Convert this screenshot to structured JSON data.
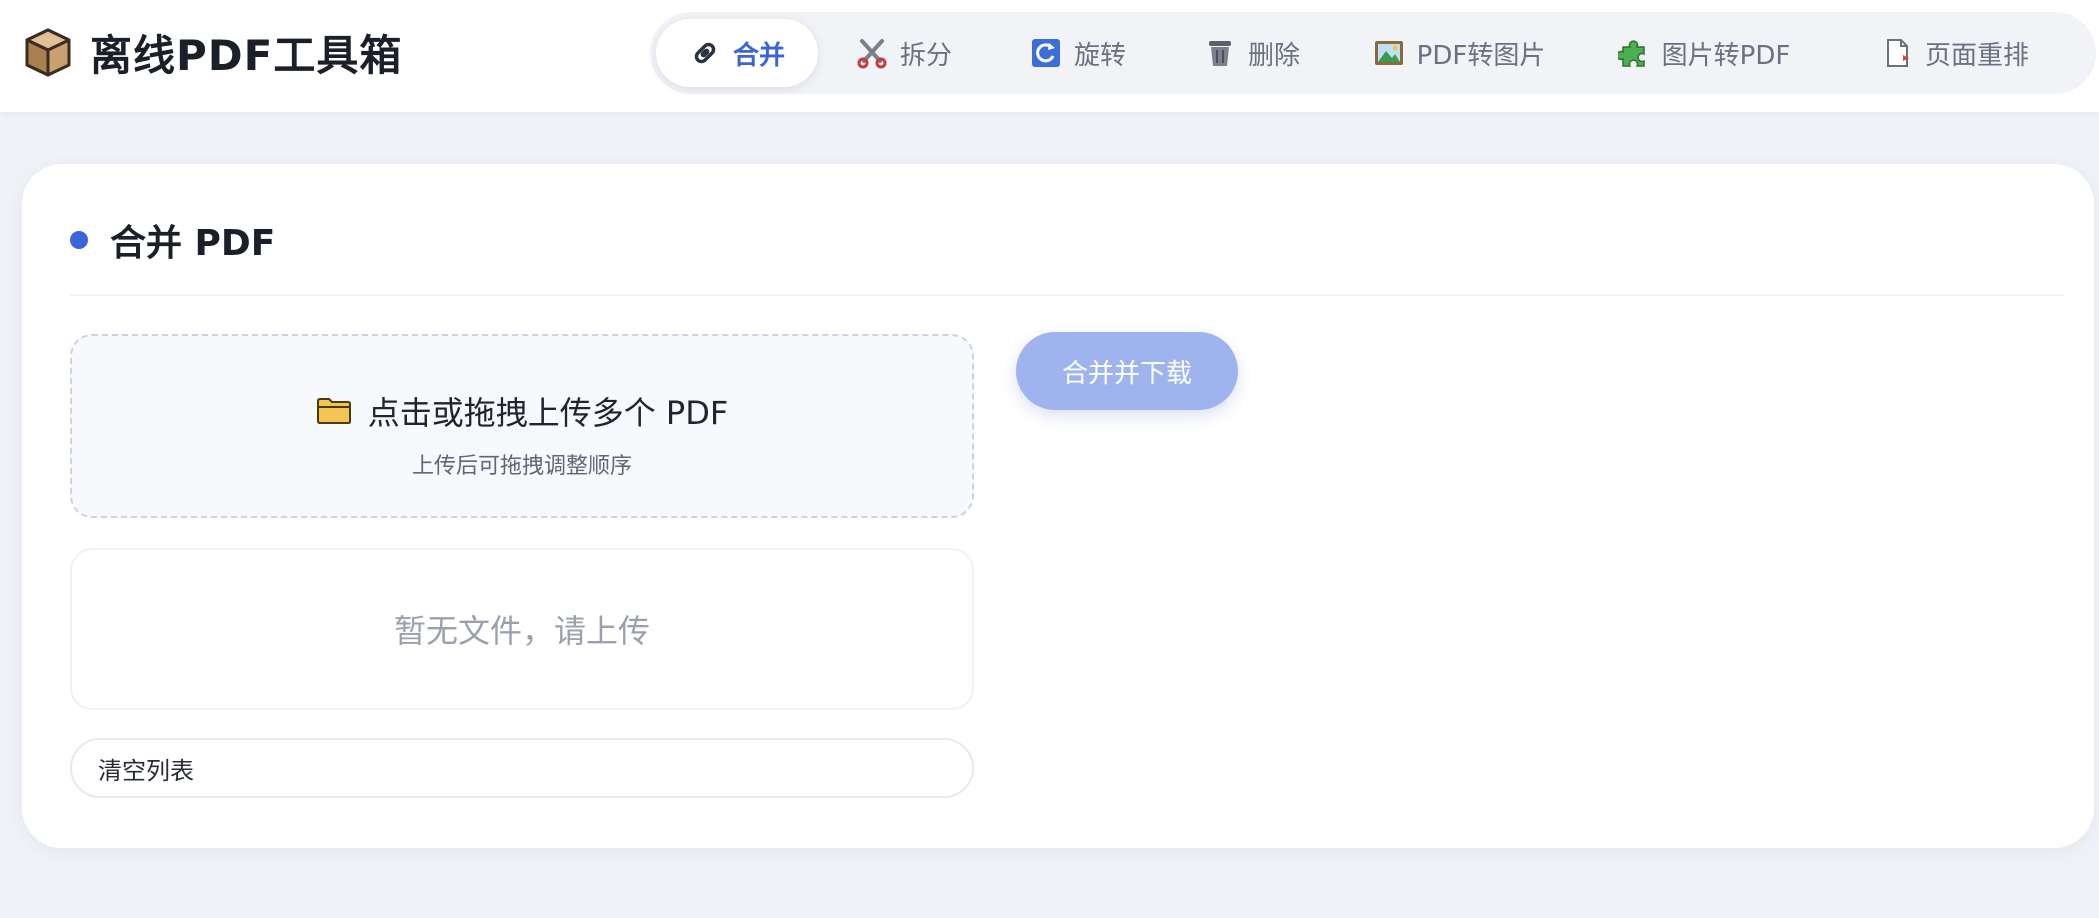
{
  "app": {
    "title": "离线PDF工具箱",
    "brand_icon": "box-icon"
  },
  "nav": {
    "items": [
      {
        "label": "合并",
        "icon": "paperclip-icon",
        "active": true
      },
      {
        "label": "拆分",
        "icon": "scissors-icon",
        "active": false
      },
      {
        "label": "旋转",
        "icon": "rotate-icon",
        "active": false
      },
      {
        "label": "删除",
        "icon": "trash-icon",
        "active": false
      },
      {
        "label": "PDF转图片",
        "icon": "picture-icon",
        "active": false
      },
      {
        "label": "图片转PDF",
        "icon": "puzzle-icon",
        "active": false
      },
      {
        "label": "页面重排",
        "icon": "page-icon",
        "active": false
      }
    ]
  },
  "section": {
    "title": "合并 PDF",
    "dot_color": "#3b64d8"
  },
  "upload": {
    "icon": "folder-icon",
    "title": "点击或拖拽上传多个 PDF",
    "subtitle": "上传后可拖拽调整顺序"
  },
  "file_list": {
    "empty_text": "暂无文件，请上传"
  },
  "actions": {
    "clear_label": "清空列表",
    "merge_label": "合并并下载",
    "merge_enabled": false
  },
  "colors": {
    "accent": "#3b64d8",
    "merge_button_disabled": "#9fb4ee",
    "background": "#eff2f6"
  }
}
